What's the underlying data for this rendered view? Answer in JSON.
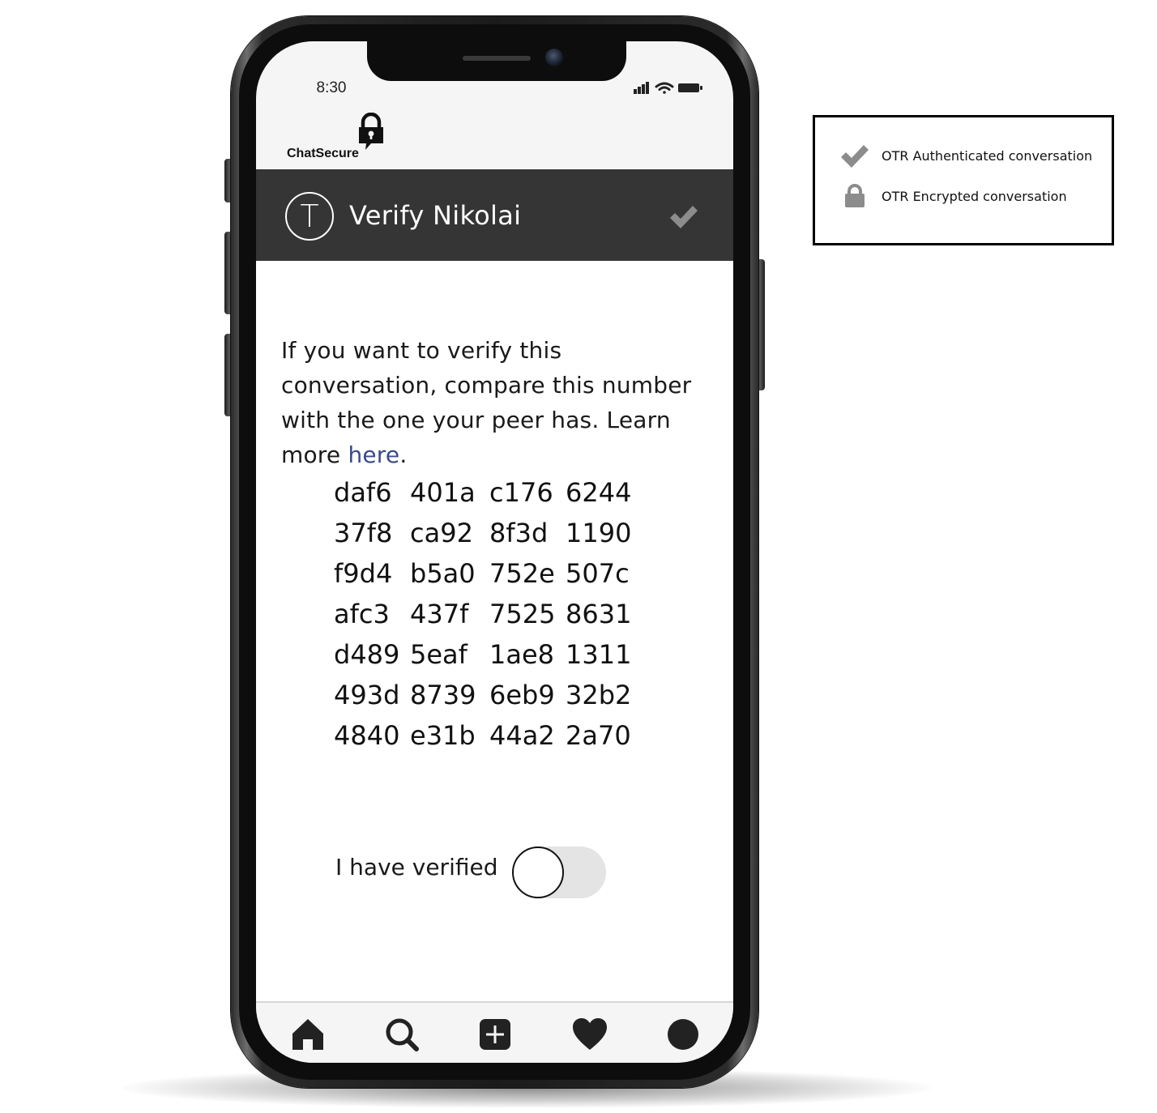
{
  "status_bar": {
    "time": "8:30"
  },
  "brand": {
    "name": "ChatSecure"
  },
  "header": {
    "avatar_letter": "T",
    "title": "Verify Nikolai",
    "status_icon": "check-icon"
  },
  "intro": {
    "text": "If you want to verify this conversation, compare this number with the one your peer has. Learn more ",
    "link_label": "here",
    "suffix": "."
  },
  "fingerprint": [
    [
      "daf6",
      "401a",
      "c176",
      "6244"
    ],
    [
      "37f8",
      "ca92",
      "8f3d",
      "1190"
    ],
    [
      "f9d4",
      "b5a0",
      "752e",
      "507c"
    ],
    [
      "afc3",
      "437f",
      "7525",
      "8631"
    ],
    [
      "d489",
      "5eaf",
      "1ae8",
      "1311"
    ],
    [
      "493d",
      "8739",
      "6eb9",
      "32b2"
    ],
    [
      "4840",
      "e31b",
      "44a2",
      "2a70"
    ]
  ],
  "verify": {
    "label": "I have verified",
    "checked": false
  },
  "bottom_nav": [
    "home-icon",
    "search-icon",
    "add-icon",
    "heart-icon",
    "profile-icon"
  ],
  "legend": {
    "items": [
      {
        "icon": "check-icon",
        "label": "OTR Authenticated conversation"
      },
      {
        "icon": "lock-icon",
        "label": "OTR Encrypted conversation"
      }
    ]
  },
  "colors": {
    "header_bg": "#353535",
    "link": "#3b4a8a",
    "icon_gray": "#8c8c8c"
  }
}
